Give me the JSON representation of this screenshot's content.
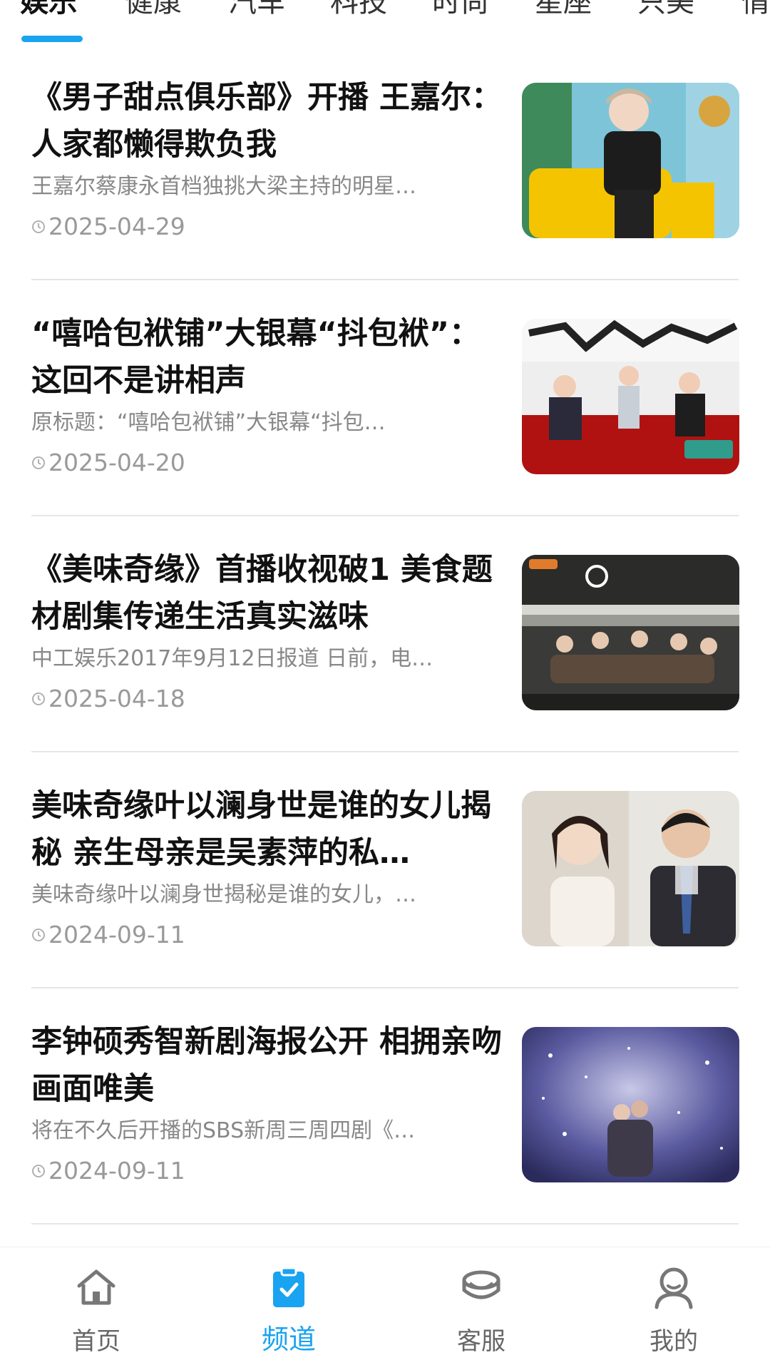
{
  "tabs": [
    "娱乐",
    "健康",
    "汽车",
    "科技",
    "时尚",
    "星座",
    "只美",
    "情"
  ],
  "active_tab_index": 0,
  "articles": [
    {
      "title": "《男子甜点俱乐部》开播 王嘉尔：人家都懒得欺负我",
      "summary": "王嘉尔蔡康永首档独挑大梁主持的明星…",
      "date": "2025-04-29"
    },
    {
      "title": "“嘻哈包袱铺”大银幕“抖包袱”：这回不是讲相声",
      "summary": "原标题：“嘻哈包袱铺”大银幕“抖包…",
      "date": "2025-04-20"
    },
    {
      "title": "《美味奇缘》首播收视破1 美食题材剧集传递生活真实滋味",
      "summary": "中工娱乐2017年9月12日报道 日前，电…",
      "date": "2025-04-18"
    },
    {
      "title": "美味奇缘叶以澜身世是谁的女儿揭秘 亲生母亲是吴素萍的私…",
      "summary": "美味奇缘叶以澜身世揭秘是谁的女儿，…",
      "date": "2024-09-11"
    },
    {
      "title": "李钟硕秀智新剧海报公开 相拥亲吻画面唯美",
      "summary": "将在不久后开播的SBS新周三周四剧《…",
      "date": "2024-09-11"
    }
  ],
  "bottom_nav": [
    {
      "label": "首页",
      "icon": "home-icon"
    },
    {
      "label": "频道",
      "icon": "clipboard-check-icon"
    },
    {
      "label": "客服",
      "icon": "headset-icon"
    },
    {
      "label": "我的",
      "icon": "user-icon"
    }
  ],
  "active_nav_index": 1,
  "colors": {
    "accent": "#1aa3f0",
    "text": "#111111",
    "muted": "#888888",
    "divider": "#e6e6e6"
  }
}
